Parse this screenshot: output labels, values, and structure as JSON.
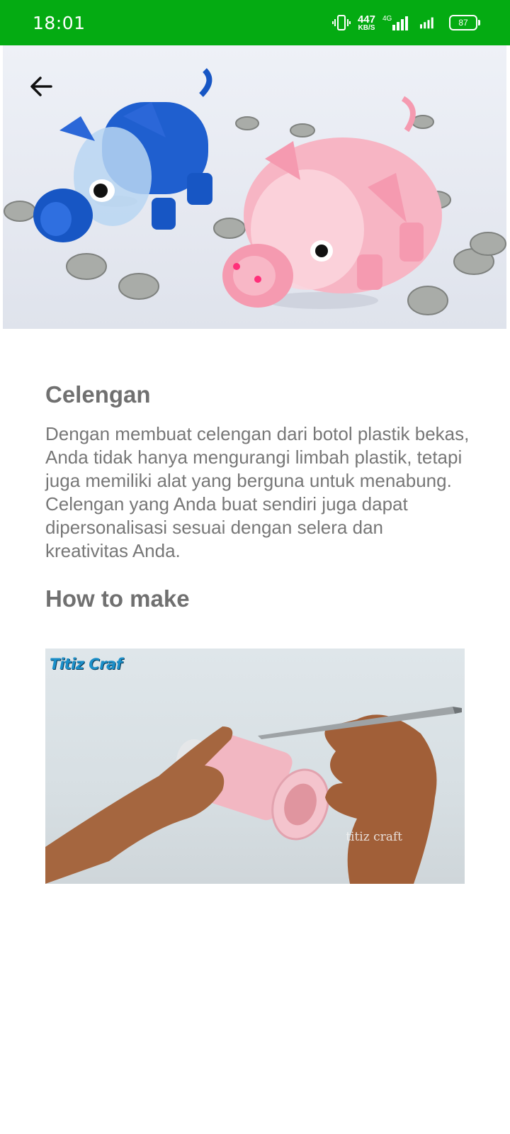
{
  "status_bar": {
    "time": "18:01",
    "net_speed_value": "447",
    "net_speed_unit": "KB/S",
    "network_type": "4G",
    "battery_level": "87",
    "icons": [
      "vibrate-icon",
      "signal-4g-icon",
      "signal-icon",
      "battery-icon"
    ]
  },
  "hero": {
    "image": "piggy-banks-photo",
    "back_icon": "arrow-left-icon"
  },
  "article": {
    "title": "Celengan",
    "description": "Dengan membuat celengan dari botol plastik bekas, Anda tidak hanya mengurangi limbah plastik, tetapi juga memiliki alat yang berguna untuk menabung. Celengan yang Anda buat sendiri juga dapat dipersonalisasi sesuai dengan selera dan kreativitas Anda.",
    "howto_heading": "How to make"
  },
  "tutorial_image": {
    "watermark": "Titiz Craf",
    "caption": "titiz craft"
  },
  "colors": {
    "status_bar": "#04ab12",
    "heading_text": "#707070",
    "body_text": "#777777"
  }
}
